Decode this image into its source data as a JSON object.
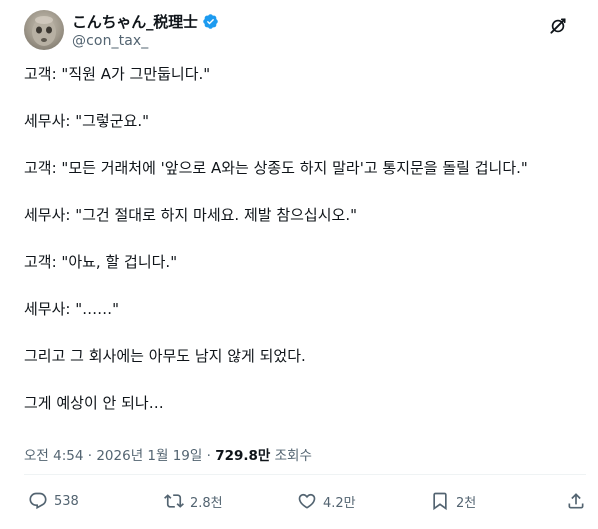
{
  "author": {
    "display_name": "こんちゃん_税理士",
    "handle": "@con_tax_",
    "verified": true,
    "verified_color": "#1d9bf0"
  },
  "post": {
    "lines": [
      "고객: \"직원 A가 그만둡니다.\"",
      "세무사: \"그렇군요.\"",
      "고객: \"모든 거래처에 '앞으로 A와는 상종도 하지 말라'고 통지문을 돌릴 겁니다.\"",
      "세무사: \"그건 절대로 하지 마세요. 제발 참으십시오.\"",
      "고객: \"아뇨, 할 겁니다.\"",
      "세무사: \"……\"",
      "그리고 그 회사에는 아무도 남지 않게 되었다.",
      "그게 예상이 안 되나…"
    ]
  },
  "meta": {
    "time": "오전 4:54",
    "date": "2026년 1월 19일",
    "separator": "·",
    "views_count": "729.8만",
    "views_label": "조회수"
  },
  "actions": {
    "replies": "538",
    "reposts": "2.8천",
    "likes": "4.2만",
    "bookmarks": "2천"
  },
  "icons": {
    "reply": "reply-icon",
    "repost": "repost-icon",
    "like": "heart-icon",
    "bookmark": "bookmark-icon",
    "share": "share-icon",
    "grok": "grok-icon",
    "verified": "verified-badge-icon"
  }
}
